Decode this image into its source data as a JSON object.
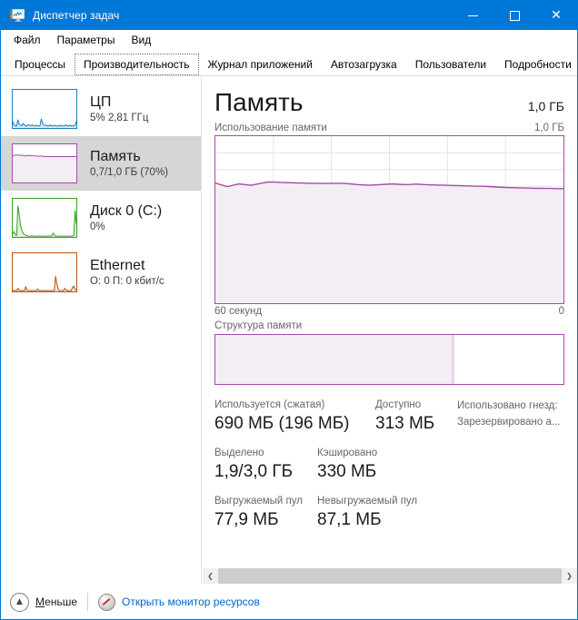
{
  "window": {
    "title": "Диспетчер задач",
    "icon": "task-manager-icon",
    "minimize": "—",
    "maximize": "□",
    "close": "✕"
  },
  "menu": {
    "items": [
      {
        "label": "Файл"
      },
      {
        "label": "Параметры"
      },
      {
        "label": "Вид"
      }
    ]
  },
  "tabs": {
    "items": [
      {
        "label": "Процессы",
        "selected": false
      },
      {
        "label": "Производительность",
        "selected": true
      },
      {
        "label": "Журнал приложений",
        "selected": false
      },
      {
        "label": "Автозагрузка",
        "selected": false
      },
      {
        "label": "Пользователи",
        "selected": false
      },
      {
        "label": "Подробности",
        "selected": false
      }
    ],
    "scroll_left": "◀",
    "scroll_right": "▶"
  },
  "sidebar": {
    "items": [
      {
        "name": "cpu",
        "title": "ЦП",
        "subtitle": "5% 2,81 ГГц",
        "color": "#1a7fc1",
        "selected": false
      },
      {
        "name": "memory",
        "title": "Память",
        "subtitle": "0,7/1,0 ГБ (70%)",
        "color": "#a24ca6",
        "selected": true
      },
      {
        "name": "disk",
        "title": "Диск 0 (C:)",
        "subtitle": "0%",
        "color": "#3a9e28",
        "selected": false
      },
      {
        "name": "ethernet",
        "title": "Ethernet",
        "subtitle": "О: 0 П: 0 кбит/с",
        "color": "#b8530d",
        "selected": false
      }
    ]
  },
  "main": {
    "title": "Память",
    "total": "1,0 ГБ",
    "graph_label": "Использование памяти",
    "graph_max": "1,0 ГБ",
    "axis_left": "60 секунд",
    "axis_right": "0",
    "composition_label": "Структура памяти",
    "composition": {
      "in_use_percent": 68,
      "divider_percent": 1,
      "free_percent": 31
    },
    "stats_row1": [
      {
        "label": "Используется (сжатая)",
        "value": "690 МБ (196 МБ)"
      },
      {
        "label": "Доступно",
        "value": "313 МБ"
      }
    ],
    "stats_notes": [
      "Использовано гнезд:",
      "Зарезервировано а..."
    ],
    "stats_row2": [
      {
        "label": "Выделено",
        "value": "1,9/3,0 ГБ"
      },
      {
        "label": "Кэшировано",
        "value": "330 МБ"
      }
    ],
    "stats_row3": [
      {
        "label": "Выгружаемый пул",
        "value": "77,9 МБ"
      },
      {
        "label": "Невыгружаемый пул",
        "value": "87,1 МБ"
      }
    ]
  },
  "scrollbar": {
    "left_arrow": "❮",
    "right_arrow": "❯"
  },
  "statusbar": {
    "less_label_prefix": "М",
    "less_label_rest": "еньше",
    "resource_monitor": "Открыть монитор ресурсов"
  },
  "chart_data": {
    "type": "area",
    "title": "Использование памяти",
    "xlabel": "60 секунд",
    "ylabel": "Память",
    "ylim": [
      0,
      100
    ],
    "xlim": [
      60,
      0
    ],
    "unit": "%",
    "grid": true,
    "line_color": "#a24ca6",
    "fill_color": "#f3eef3",
    "values": [
      72.0,
      70.8,
      69.8,
      70.6,
      71.4,
      71.0,
      70.6,
      71.2,
      72.0,
      72.6,
      72.5,
      72.3,
      72.2,
      72.1,
      72.0,
      71.9,
      71.8,
      71.8,
      71.7,
      71.7,
      71.8,
      71.8,
      71.7,
      71.4,
      71.0,
      70.8,
      70.6,
      70.8,
      71.0,
      71.2,
      71.4,
      71.2,
      71.0,
      71.1,
      71.3,
      71.1,
      70.9,
      70.8,
      70.7,
      70.6,
      70.5,
      70.4,
      70.3,
      70.2,
      70.1,
      70.0,
      69.9,
      69.7,
      69.5,
      69.3,
      69.2,
      69.1,
      69.0,
      68.9,
      68.8,
      68.8,
      68.7,
      68.7,
      68.6,
      68.6
    ],
    "sidebar_sparklines": {
      "cpu": {
        "color": "#1a7fc1",
        "values": [
          18,
          8,
          6,
          5,
          22,
          10,
          7,
          6,
          12,
          8,
          6,
          5,
          9,
          7,
          6,
          8,
          6,
          5,
          7,
          6,
          5,
          6,
          24,
          12,
          8,
          6,
          7,
          5,
          6,
          8,
          6,
          5,
          7,
          6,
          5,
          6,
          5,
          7,
          6,
          5,
          6,
          8,
          6,
          5,
          7,
          6,
          5,
          6,
          7,
          18
        ]
      },
      "memory": {
        "color": "#a24ca6",
        "values": [
          70,
          71,
          72,
          72,
          72,
          71,
          71,
          71,
          71,
          70,
          70,
          70,
          71,
          71,
          70,
          70,
          70,
          70,
          69,
          69,
          69,
          69,
          69,
          69,
          68,
          68,
          68,
          68,
          68,
          68,
          68,
          68,
          68,
          68,
          68,
          68,
          68,
          68,
          68,
          68,
          68,
          68,
          68,
          68,
          68,
          68,
          68,
          68,
          68,
          68
        ]
      },
      "disk": {
        "color": "#3a9e28",
        "values": [
          8,
          14,
          6,
          4,
          82,
          60,
          30,
          18,
          10,
          6,
          4,
          3,
          2,
          2,
          2,
          3,
          2,
          2,
          2,
          2,
          3,
          2,
          2,
          2,
          2,
          2,
          2,
          2,
          3,
          2,
          2,
          10,
          6,
          2,
          2,
          2,
          2,
          2,
          2,
          2,
          2,
          2,
          2,
          2,
          2,
          2,
          2,
          4,
          70,
          34
        ]
      },
      "ethernet": {
        "color": "#b8530d",
        "values": [
          2,
          3,
          2,
          2,
          8,
          3,
          2,
          2,
          2,
          2,
          12,
          4,
          2,
          2,
          2,
          2,
          2,
          2,
          2,
          6,
          3,
          2,
          2,
          2,
          2,
          2,
          2,
          2,
          2,
          2,
          2,
          2,
          2,
          40,
          20,
          6,
          2,
          2,
          2,
          2,
          8,
          4,
          2,
          2,
          2,
          2,
          10,
          14,
          6,
          3
        ]
      }
    }
  }
}
